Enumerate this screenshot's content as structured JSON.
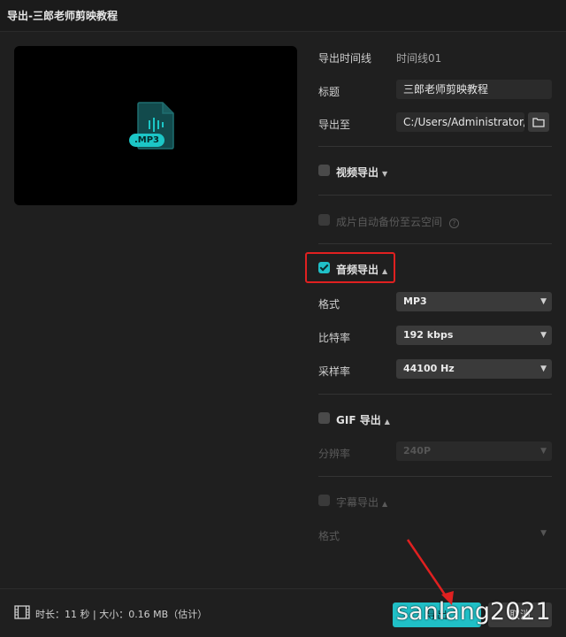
{
  "window": {
    "title": "导出-三郎老师剪映教程"
  },
  "preview": {
    "badge": ".MP3",
    "icon": "audio-file-icon"
  },
  "form": {
    "timeline_label": "导出时间线",
    "timeline_value": "时间线01",
    "title_label": "标题",
    "title_value": "三郎老师剪映教程",
    "export_to_label": "导出至",
    "export_to_value": "C:/Users/Administrator/..."
  },
  "video_section": {
    "label": "视频导出",
    "checked": false
  },
  "backup": {
    "label": "成片自动备份至云空间",
    "enabled": false
  },
  "audio_section": {
    "label": "音频导出",
    "checked": true,
    "format_label": "格式",
    "format_value": "MP3",
    "bitrate_label": "比特率",
    "bitrate_value": "192 kbps",
    "samplerate_label": "采样率",
    "samplerate_value": "44100 Hz"
  },
  "gif_section": {
    "label": "GIF 导出",
    "checked": false,
    "resolution_label": "分辨率",
    "resolution_value": "240P"
  },
  "subtitle_section": {
    "label": "字幕导出",
    "checked": false,
    "format_label": "格式"
  },
  "footer": {
    "info": "时长：11 秒 | 大小：0.16 MB（估计）",
    "export_label": "导出",
    "cancel_label": "取消"
  },
  "watermark": "sanlang2021",
  "colors": {
    "accent": "#20bfc6",
    "highlight": "#e02020",
    "background": "#1f1f1f"
  }
}
